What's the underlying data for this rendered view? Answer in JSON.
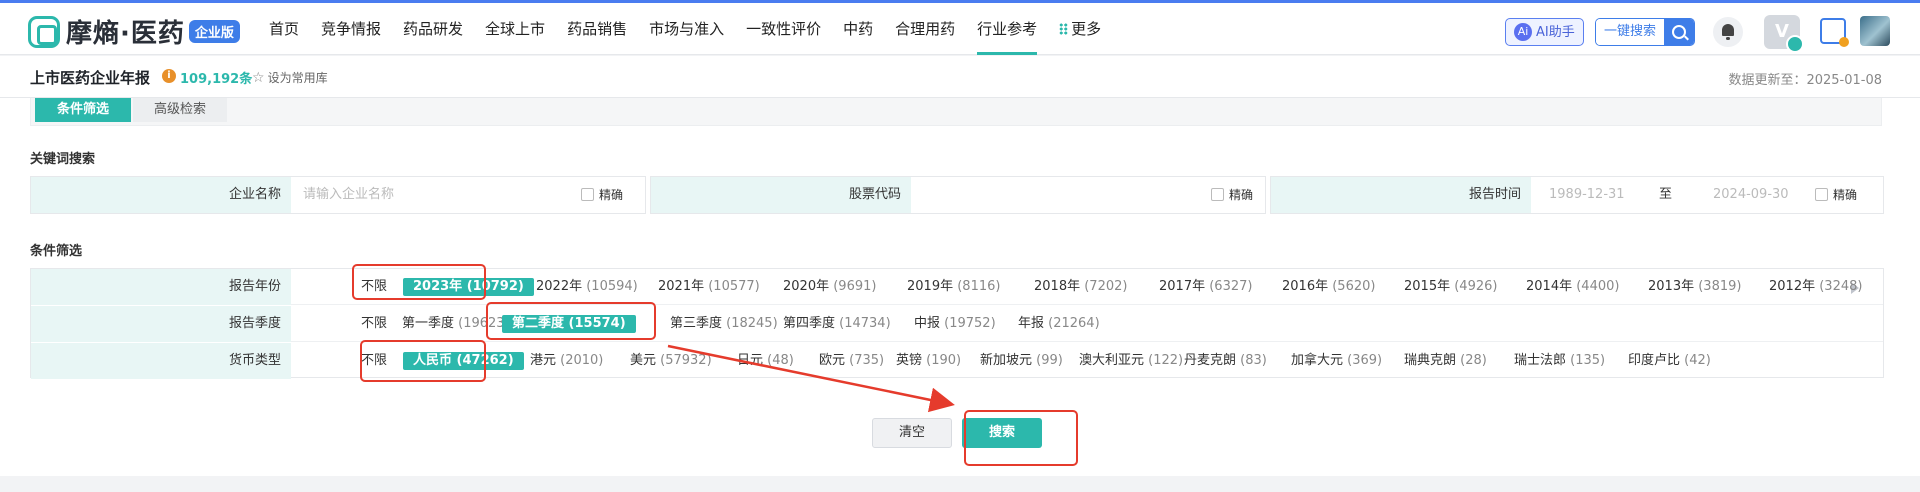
{
  "brand": {
    "name": "摩熵·医药",
    "badge": "企业版"
  },
  "nav": [
    "首页",
    "竞争情报",
    "药品研发",
    "全球上市",
    "药品销售",
    "市场与准入",
    "一致性评价",
    "中药",
    "合理用药",
    "行业参考",
    "更多"
  ],
  "nav_active": "行业参考",
  "toolbar": {
    "ai_label": "AI助手",
    "ai_icon": "Ai",
    "one_search_label": "一键搜索",
    "vip_label": "V"
  },
  "header": {
    "title": "上市医药企业年报",
    "count": "109,192条",
    "favorite": "设为常用库",
    "updated": "数据更新至：2025-01-08"
  },
  "tabs": [
    "条件筛选",
    "高级检索"
  ],
  "keyword_section": {
    "title": "关键词搜索",
    "company_label": "企业名称",
    "company_placeholder": "请输入企业名称",
    "stock_label": "股票代码",
    "time_label": "报告时间",
    "date_from": "1989-12-31",
    "date_sep": "至",
    "date_to": "2024-09-30",
    "exact_label": "精确"
  },
  "filter_section": {
    "title": "条件筛选",
    "rows": [
      {
        "label": "报告年份",
        "options": [
          {
            "t": "不限",
            "n": ""
          },
          {
            "t": "2023年",
            "n": "(10792)"
          },
          {
            "t": "2022年",
            "n": "(10594)"
          },
          {
            "t": "2021年",
            "n": "(10577)"
          },
          {
            "t": "2020年",
            "n": "(9691)"
          },
          {
            "t": "2019年",
            "n": "(8116)"
          },
          {
            "t": "2018年",
            "n": "(7202)"
          },
          {
            "t": "2017年",
            "n": "(6327)"
          },
          {
            "t": "2016年",
            "n": "(5620)"
          },
          {
            "t": "2015年",
            "n": "(4926)"
          },
          {
            "t": "2014年",
            "n": "(4400)"
          },
          {
            "t": "2013年",
            "n": "(3819)"
          },
          {
            "t": "2012年",
            "n": "(3248)"
          }
        ],
        "selected": 1
      },
      {
        "label": "报告季度",
        "options": [
          {
            "t": "不限",
            "n": ""
          },
          {
            "t": "第一季度",
            "n": "(19623)"
          },
          {
            "t": "第二季度",
            "n": "(15574)"
          },
          {
            "t": "第三季度",
            "n": "(18245)"
          },
          {
            "t": "第四季度",
            "n": "(14734)"
          },
          {
            "t": "中报",
            "n": "(19752)"
          },
          {
            "t": "年报",
            "n": "(21264)"
          }
        ],
        "selected": 2
      },
      {
        "label": "货币类型",
        "options": [
          {
            "t": "不限",
            "n": ""
          },
          {
            "t": "人民币",
            "n": "(47262)"
          },
          {
            "t": "港元",
            "n": "(2010)"
          },
          {
            "t": "美元",
            "n": "(57932)"
          },
          {
            "t": "日元",
            "n": "(48)"
          },
          {
            "t": "欧元",
            "n": "(735)"
          },
          {
            "t": "英镑",
            "n": "(190)"
          },
          {
            "t": "新加坡元",
            "n": "(99)"
          },
          {
            "t": "澳大利亚元",
            "n": "(122)"
          },
          {
            "t": "丹麦克朗",
            "n": "(83)"
          },
          {
            "t": "加拿大元",
            "n": "(369)"
          },
          {
            "t": "瑞典克朗",
            "n": "(28)"
          },
          {
            "t": "瑞士法郎",
            "n": "(135)"
          },
          {
            "t": "印度卢比",
            "n": "(42)"
          }
        ],
        "selected": 1
      }
    ]
  },
  "actions": {
    "clear": "清空",
    "search": "搜索"
  },
  "colors": {
    "accent": "#2cb8ac",
    "annotation": "#e53b2c",
    "nav_border": "#4a7cf0"
  }
}
